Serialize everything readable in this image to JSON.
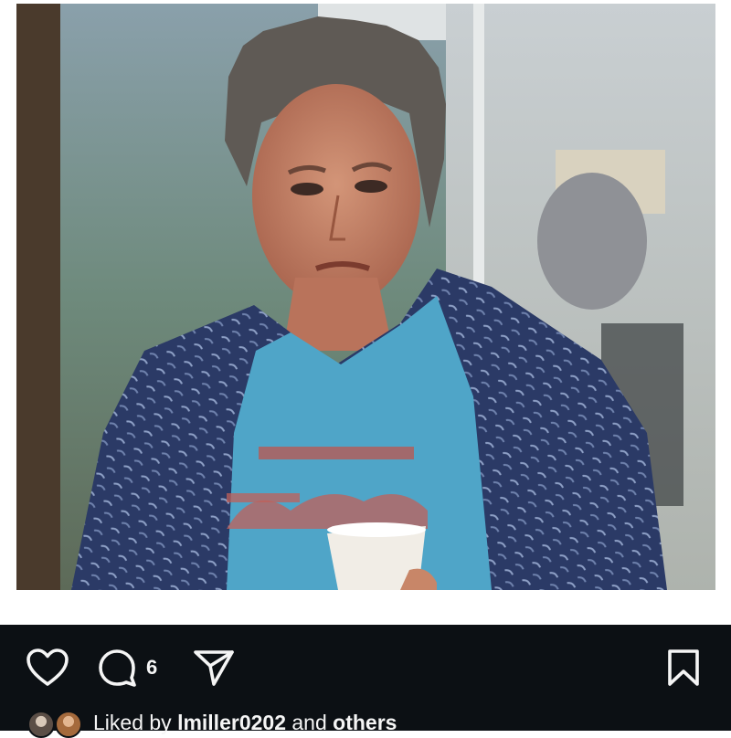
{
  "post": {
    "image_alt": "Photo of a man with spiky grey hair in an open blue patterned shirt over a light blue t-shirt, holding a white paper cup"
  },
  "actions": {
    "like_icon": "heart-outline-icon",
    "comment_icon": "comment-bubble-icon",
    "comment_count": "6",
    "share_icon": "paper-plane-icon",
    "save_icon": "bookmark-icon"
  },
  "likes": {
    "prefix": "Liked by ",
    "user": "lmiller0202",
    "middle": " and ",
    "others": "others"
  },
  "colors": {
    "bar_background": "#0c1014",
    "icon_color": "#f5f5f5",
    "page_background": "#ffffff"
  }
}
